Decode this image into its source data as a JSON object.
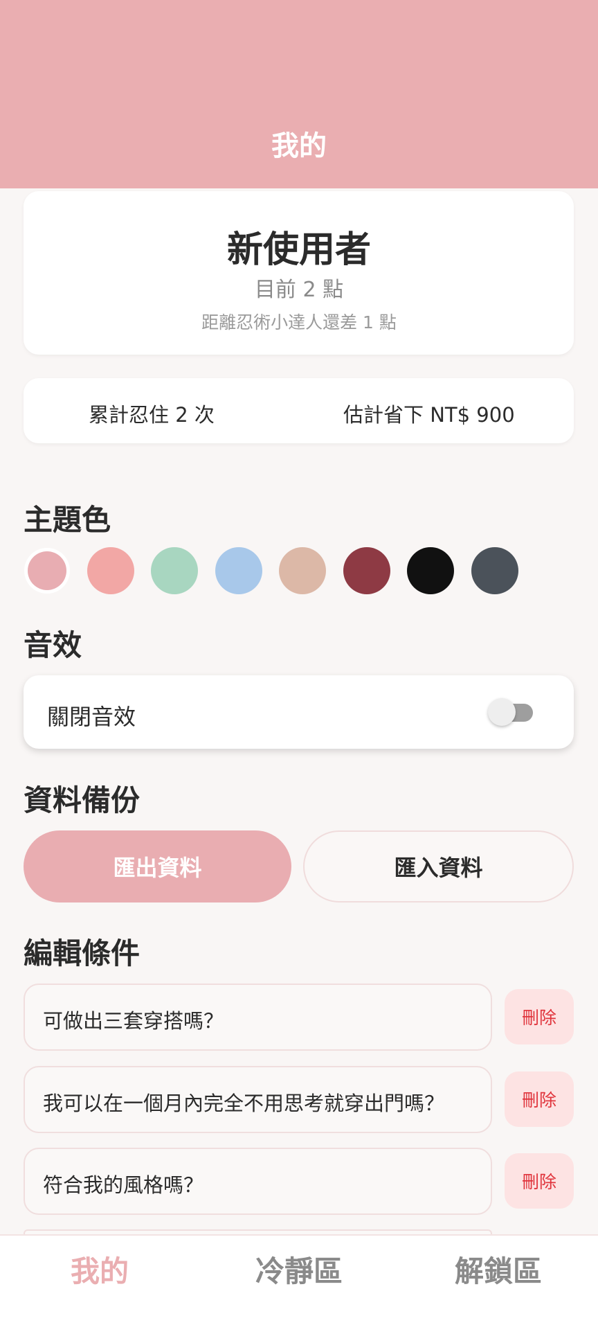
{
  "header": {
    "title": "我的"
  },
  "profile": {
    "name": "新使用者",
    "points": "目前 2 點",
    "next_level": "距離忍術小達人還差 1 點"
  },
  "stats": {
    "resist_count": "累計忍住 2 次",
    "saved": "估計省下 NT$ 900"
  },
  "theme": {
    "title": "主題色",
    "colors": [
      "#e8adb2",
      "#f2a7a5",
      "#a8d6c0",
      "#a8c8ea",
      "#dcb8a7",
      "#8e3a44",
      "#111111",
      "#4b525a"
    ],
    "selected_index": 0
  },
  "sound": {
    "title": "音效",
    "toggle_label": "關閉音效",
    "enabled": false
  },
  "backup": {
    "title": "資料備份",
    "export_label": "匯出資料",
    "import_label": "匯入資料"
  },
  "conditions": {
    "title": "編輯條件",
    "delete_label": "刪除",
    "items": [
      {
        "text": "可做出三套穿搭嗎？"
      },
      {
        "text": "我可以在一個月內完全不用思考就穿出門嗎？"
      },
      {
        "text": "符合我的風格嗎？"
      }
    ]
  },
  "nav": {
    "items": [
      {
        "label": "我的",
        "active": true
      },
      {
        "label": "冷靜區",
        "active": false
      },
      {
        "label": "解鎖區",
        "active": false
      }
    ],
    "active_color": "#eaaeb1",
    "inactive_color": "#8a8a8a"
  }
}
